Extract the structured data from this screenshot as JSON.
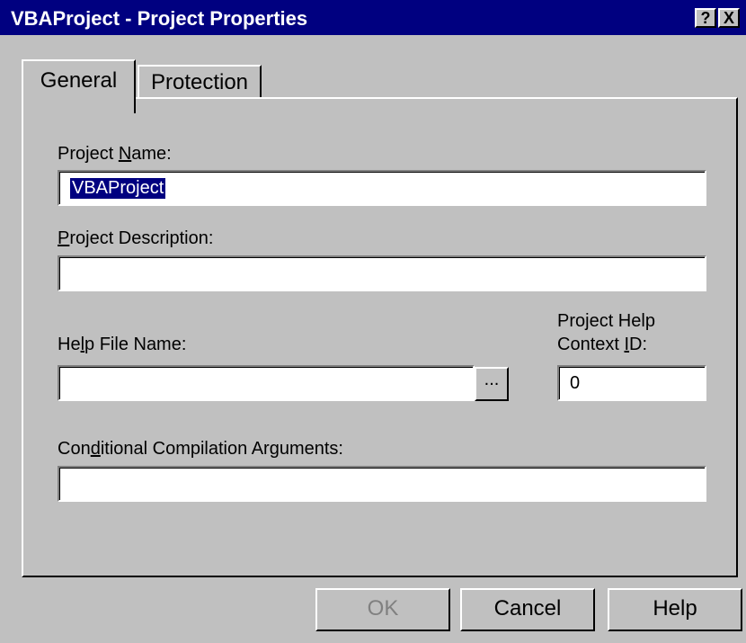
{
  "window": {
    "title": "VBAProject - Project Properties",
    "help_button": "?",
    "close_button": "X"
  },
  "tabs": [
    {
      "label": "General",
      "active": true
    },
    {
      "label": "Protection",
      "active": false
    }
  ],
  "form": {
    "project_name": {
      "label_pre": "Project ",
      "label_mnemonic": "N",
      "label_post": "ame:",
      "value": "VBAProject"
    },
    "project_description": {
      "label_pre": "",
      "label_mnemonic": "P",
      "label_post": "roject Description:",
      "value": ""
    },
    "help_file_name": {
      "label_pre": "He",
      "label_mnemonic": "l",
      "label_post": "p File Name:",
      "value": "",
      "browse_label": "..."
    },
    "help_context_id": {
      "label_line1": "Project Help",
      "label_pre": "Context ",
      "label_mnemonic": "I",
      "label_post": "D:",
      "value": "0"
    },
    "conditional_compilation": {
      "label_pre": "Con",
      "label_mnemonic": "d",
      "label_post": "itional Compilation Arguments:",
      "value": ""
    }
  },
  "buttons": {
    "ok": "OK",
    "cancel": "Cancel",
    "help": "Help"
  },
  "colors": {
    "titlebar": "#000080",
    "face": "#c0c0c0",
    "selection": "#000080"
  }
}
